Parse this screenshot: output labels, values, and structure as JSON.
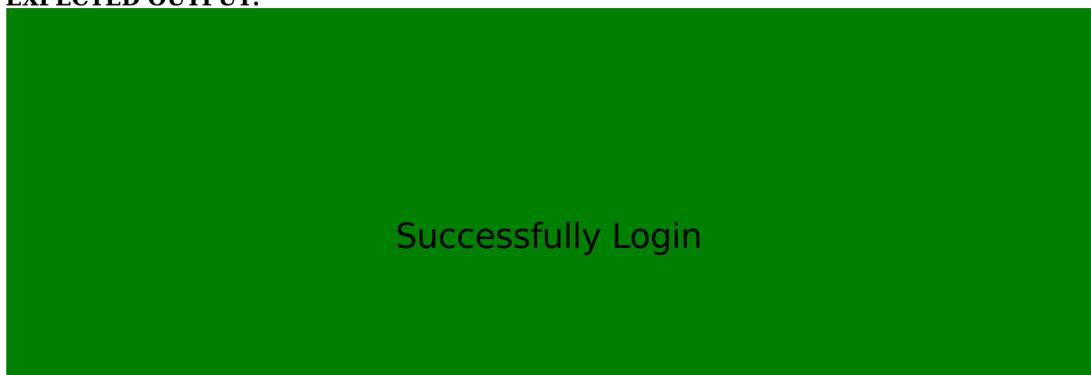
{
  "header": {
    "label": "EXPECTED OUTPUT:"
  },
  "panel": {
    "message": "Successfully Login",
    "background_color": "#008000",
    "text_color": "#000000"
  }
}
